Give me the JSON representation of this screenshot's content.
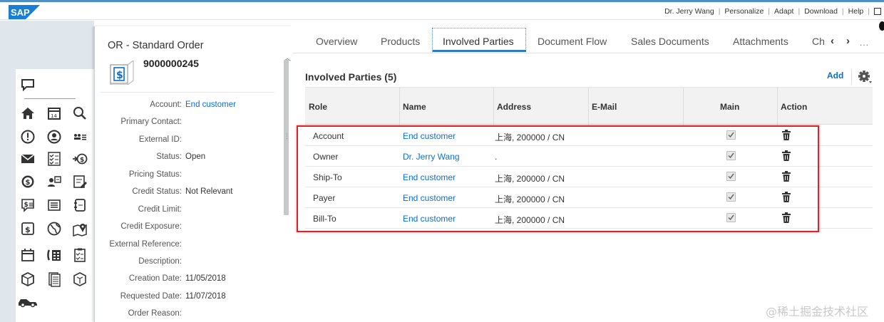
{
  "top_bar": {
    "logo_text": "SAP",
    "links": [
      "Dr. Jerry Wang",
      "Personalize",
      "Adapt",
      "Download",
      "Help"
    ]
  },
  "side_icons": [
    "message-icon",
    "home-icon",
    "calendar-icon",
    "search-icon",
    "alert-icon",
    "person-icon",
    "org-icon",
    "mail-icon",
    "checklist-icon",
    "payment-icon",
    "dollar-circle-icon",
    "contact-card-icon",
    "edit-doc-icon",
    "invoice-icon",
    "list-icon",
    "note-icon",
    "dollar-doc-icon",
    "globe-icon",
    "map-pin-icon",
    "schedule-icon",
    "phone-book-icon",
    "task-icon",
    "product-icon",
    "document-icon",
    "box-icon",
    "car-icon"
  ],
  "header": {
    "title": "OR - Standard Order",
    "number": "9000000245",
    "fields": [
      {
        "label": "Account:",
        "value": "End customer",
        "link": true
      },
      {
        "label": "Primary Contact:",
        "value": ""
      },
      {
        "label": "External ID:",
        "value": ""
      },
      {
        "label": "Status:",
        "value": "Open"
      },
      {
        "label": "Pricing Status:",
        "value": ""
      },
      {
        "label": "Credit Status:",
        "value": "Not Relevant"
      },
      {
        "label": "Credit Limit:",
        "value": ""
      },
      {
        "label": "Credit Exposure:",
        "value": ""
      },
      {
        "label": "External Reference:",
        "value": ""
      },
      {
        "label": "Description:",
        "value": ""
      },
      {
        "label": "Creation Date:",
        "value": "11/05/2018"
      },
      {
        "label": "Requested Date:",
        "value": "11/07/2018"
      },
      {
        "label": "Order Reason:",
        "value": ""
      }
    ]
  },
  "tabs": [
    "Overview",
    "Products",
    "Involved Parties",
    "Document Flow",
    "Sales Documents",
    "Attachments",
    "Ch"
  ],
  "active_tab": "Involved Parties",
  "tab_more": "...",
  "section": {
    "title": "Involved Parties (5)",
    "add_label": "Add"
  },
  "table": {
    "columns": [
      "Role",
      "Name",
      "Address",
      "E-Mail",
      "Main",
      "Action"
    ],
    "rows": [
      {
        "role": "Account",
        "name": "End customer",
        "address": "上海, 200000 / CN",
        "email": "",
        "main": true
      },
      {
        "role": "Owner",
        "name": "Dr. Jerry Wang",
        "address": ".",
        "email": "",
        "main": true
      },
      {
        "role": "Ship-To",
        "name": "End customer",
        "address": "上海, 200000 / CN",
        "email": "",
        "main": true
      },
      {
        "role": "Payer",
        "name": "End customer",
        "address": "上海, 200000 / CN",
        "email": "",
        "main": true
      },
      {
        "role": "Bill-To",
        "name": "End customer",
        "address": "上海, 200000 / CN",
        "email": "",
        "main": true
      }
    ]
  },
  "colors": {
    "link": "#0a6ed1",
    "highlight": "#d7262b",
    "tab_underline": "#2f7bc0",
    "side_bg": "#dfe6ec"
  },
  "watermark": "@稀土掘金技术社区"
}
